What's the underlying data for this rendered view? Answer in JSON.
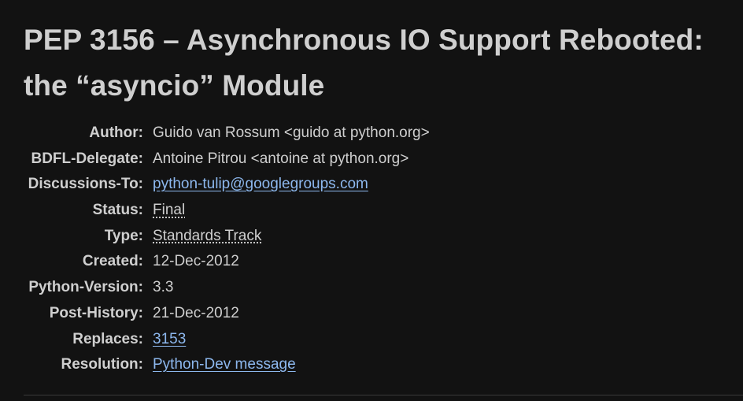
{
  "title": "PEP 3156 – Asynchronous IO Support Rebooted: the “asyncio” Module",
  "metadata": {
    "author": {
      "label": "Author:",
      "value": "Guido van Rossum <guido at python.org>"
    },
    "bdfl_delegate": {
      "label": "BDFL-Delegate:",
      "value": "Antoine Pitrou <antoine at python.org>"
    },
    "discussions_to": {
      "label": "Discussions-To:",
      "value": "python-tulip@googlegroups.com"
    },
    "status": {
      "label": "Status:",
      "value": "Final"
    },
    "type": {
      "label": "Type:",
      "value": "Standards Track"
    },
    "created": {
      "label": "Created:",
      "value": "12-Dec-2012"
    },
    "python_version": {
      "label": "Python-Version:",
      "value": "3.3"
    },
    "post_history": {
      "label": "Post-History:",
      "value": "21-Dec-2012"
    },
    "replaces": {
      "label": "Replaces:",
      "value": "3153"
    },
    "resolution": {
      "label": "Resolution:",
      "value": "Python-Dev message"
    }
  },
  "colors": {
    "background": "#121212",
    "text": "#cfcfcf",
    "link": "#8db8ee"
  }
}
